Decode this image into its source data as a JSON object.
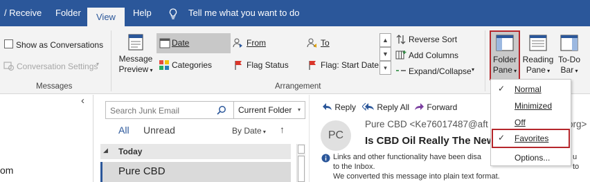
{
  "tabs": {
    "send_receive": "/ Receive",
    "folder": "Folder",
    "view": "View",
    "help": "Help",
    "tell_me": "Tell me what you want to do"
  },
  "ribbon": {
    "show_as_conversations": "Show as Conversations",
    "conversation_settings": "Conversation Settings",
    "messages_group": "Messages",
    "message_preview_line1": "Message",
    "message_preview_line2": "Preview",
    "arrangement_group": "Arrangement",
    "arrangement": {
      "date": "Date",
      "from": "From",
      "to": "To",
      "categories": "Categories",
      "flag_status": "Flag Status",
      "flag_start_date": "Flag: Start Date"
    },
    "reverse_sort": "Reverse Sort",
    "add_columns": "Add Columns",
    "expand_collapse": "Expand/Collapse",
    "folder_pane_line1": "Folder",
    "folder_pane_line2": "Pane",
    "reading_pane_line1": "Reading",
    "reading_pane_line2": "Pane",
    "todo_bar_line1": "To-Do",
    "todo_bar_line2": "Bar"
  },
  "folder_pane": {
    "collapse_glyph": "‹",
    "partial_item": "om"
  },
  "message_list": {
    "search_placeholder": "Search Junk Email",
    "scope": "Current Folder",
    "filter_all": "All",
    "filter_unread": "Unread",
    "sort_by": "By Date",
    "group_today": "Today",
    "selected_sender": "Pure CBD"
  },
  "reading_pane": {
    "reply": "Reply",
    "reply_all": "Reply All",
    "forward": "Forward",
    "avatar_initials": "PC",
    "sender": "Pure CBD <Ke76017487@aft",
    "sender_tail": "org>",
    "subject": "Is CBD Oil Really The New",
    "info_line1": "Links and other functionality have been disa",
    "info_line1_tail": "u",
    "info_line2": "to the Inbox.",
    "info_line3": "We converted this message into plain text format.",
    "partial_right": "to"
  },
  "folder_pane_menu": {
    "items": [
      "Normal",
      "Minimized",
      "Off",
      "Favorites",
      "Options..."
    ],
    "checked": [
      "Normal",
      "Favorites"
    ]
  },
  "colors": {
    "brand_blue": "#2b579a",
    "highlight_red": "#b5262b",
    "selected_row": "#dadada"
  }
}
